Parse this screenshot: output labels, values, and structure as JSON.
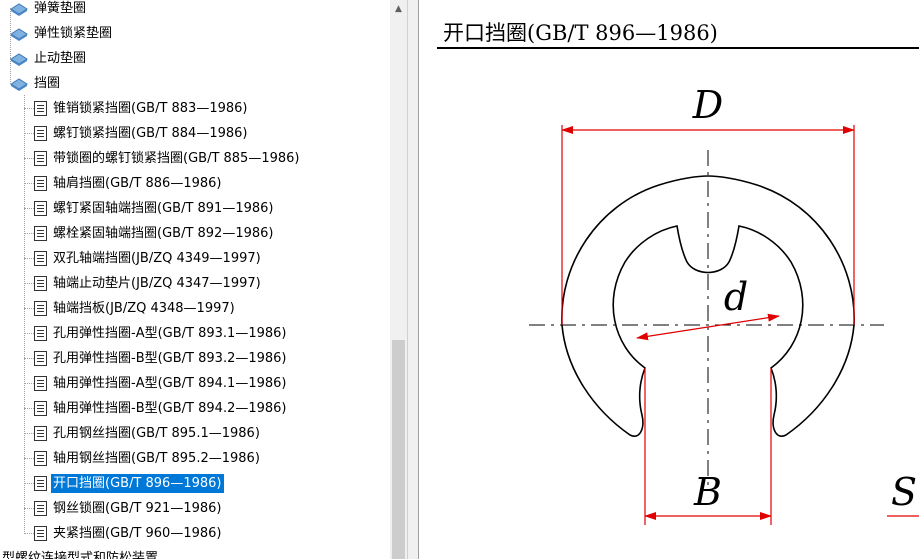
{
  "tree": {
    "top_items": [
      {
        "label": "弹簧垫圈",
        "icon": "folder-icon"
      },
      {
        "label": "弹性锁紧垫圈",
        "icon": "folder-icon"
      },
      {
        "label": "止动垫圈",
        "icon": "folder-icon"
      },
      {
        "label": "挡圈",
        "icon": "folder-icon"
      }
    ],
    "children": [
      {
        "label": "锥销锁紧挡圈(GB/T 883—1986)"
      },
      {
        "label": "螺钉锁紧挡圈(GB/T 884—1986)"
      },
      {
        "label": "带锁圈的螺钉锁紧挡圈(GB/T 885—1986)"
      },
      {
        "label": "轴肩挡圈(GB/T 886—1986)"
      },
      {
        "label": "螺钉紧固轴端挡圈(GB/T 891—1986)"
      },
      {
        "label": "螺栓紧固轴端挡圈(GB/T 892—1986)"
      },
      {
        "label": "双孔轴端挡圈(JB/ZQ 4349—1997)"
      },
      {
        "label": "轴端止动垫片(JB/ZQ 4347—1997)"
      },
      {
        "label": "轴端挡板(JB/ZQ 4348—1997)"
      },
      {
        "label": "孔用弹性挡圈-A型(GB/T 893.1—1986)"
      },
      {
        "label": "孔用弹性挡圈-B型(GB/T 893.2—1986)"
      },
      {
        "label": "轴用弹性挡圈-A型(GB/T 894.1—1986)"
      },
      {
        "label": "轴用弹性挡圈-B型(GB/T 894.2—1986)"
      },
      {
        "label": "孔用钢丝挡圈(GB/T 895.1—1986)"
      },
      {
        "label": "轴用钢丝挡圈(GB/T 895.2—1986)"
      },
      {
        "label": "开口挡圈(GB/T 896—1986)",
        "selected": true
      },
      {
        "label": "钢丝锁圈(GB/T 921—1986)"
      },
      {
        "label": "夹紧挡圈(GB/T 960—1986)"
      }
    ],
    "bottom_partial": "型螺纹连接型式和防松装置"
  },
  "document": {
    "title": "开口挡圈(GB/T 896—1986)",
    "labels": {
      "D": "D",
      "d": "d",
      "B": "B",
      "S": "S"
    }
  },
  "colors": {
    "selection": "#0078d7",
    "dimension": "#e00000",
    "outline": "#000000"
  }
}
